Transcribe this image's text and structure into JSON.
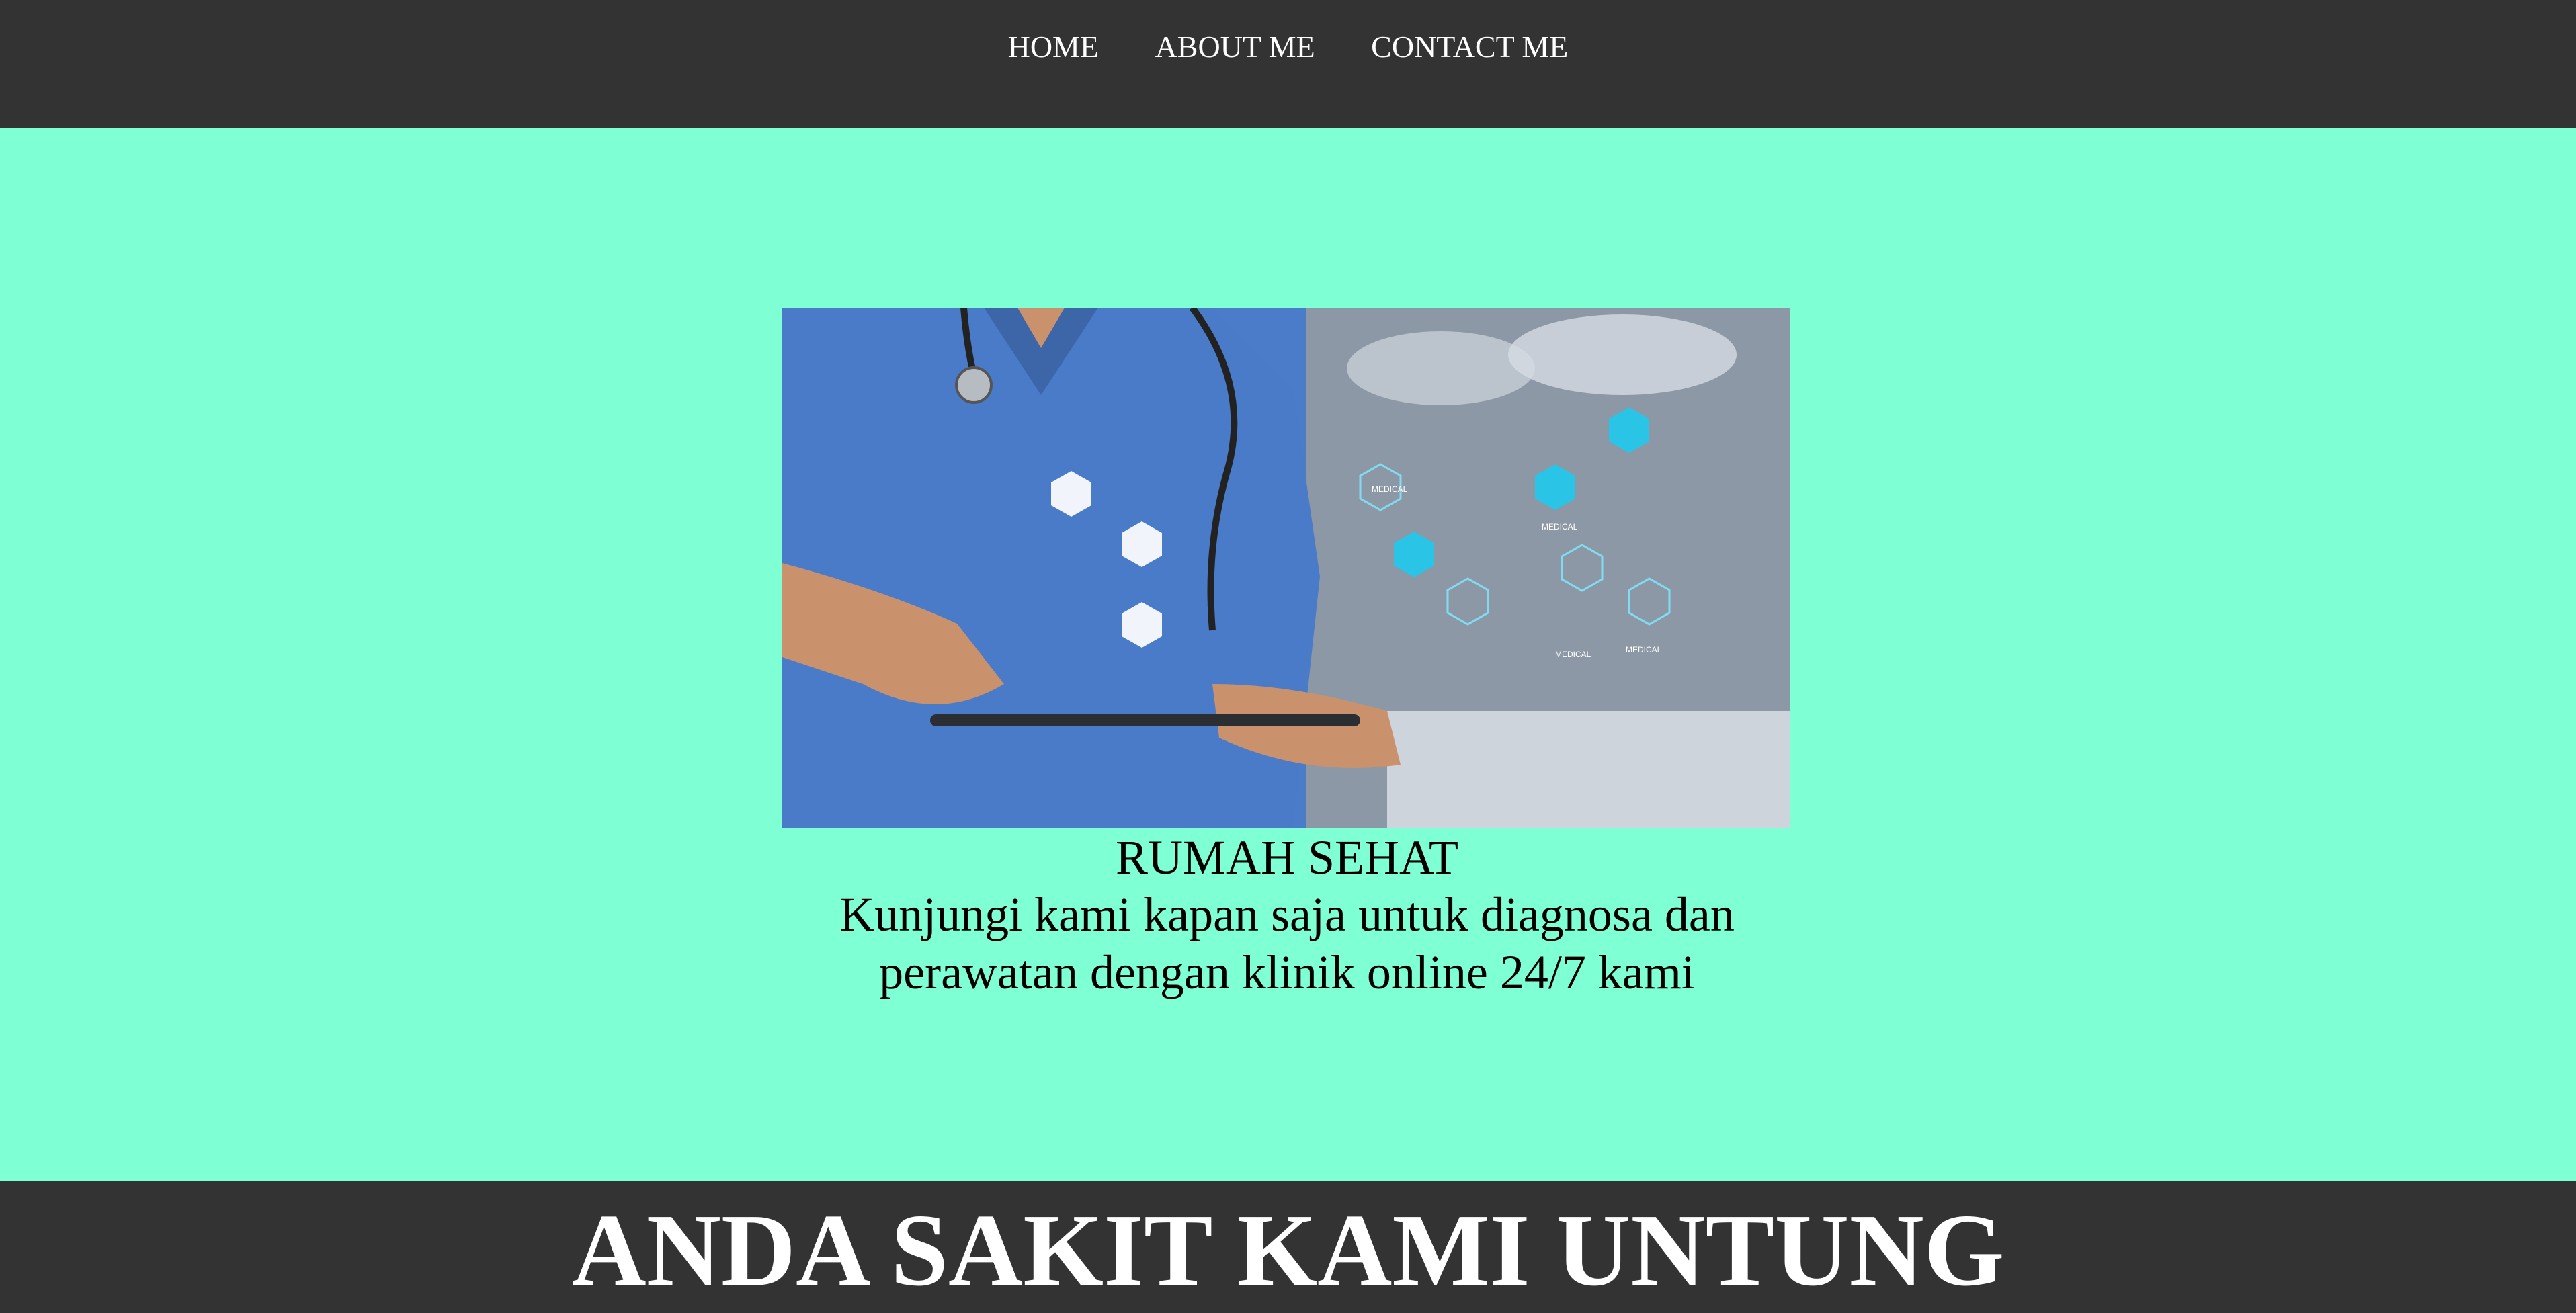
{
  "nav": {
    "items": [
      {
        "label": "HOME"
      },
      {
        "label": "ABOUT ME"
      },
      {
        "label": "CONTACT ME"
      }
    ]
  },
  "hero": {
    "image_icons": [
      "eye-icon",
      "heart-icon",
      "user-icon",
      "medical-cross-icon",
      "pill-icon",
      "stethoscope-icon",
      "test-tubes-icon",
      "microscope-icon",
      "molecule-icon",
      "first-aid-kit-icon",
      "blood-drop-icon",
      "clipboard-icon"
    ],
    "image_labels": [
      "MEDICAL",
      "MEDICAL",
      "MEDICAL",
      "MEDICAL"
    ],
    "title": "RUMAH SEHAT",
    "subtitle": "Kunjungi kami kapan saja untuk diagnosa dan perawatan dengan klinik online 24/7 kami"
  },
  "footer": {
    "tagline": "ANDA SAKIT KAMI UNTUNG"
  },
  "colors": {
    "nav_bg": "#333333",
    "page_bg": "#7fffd4",
    "text_light": "#ffffff",
    "accent_icon": "#29c4e6"
  }
}
